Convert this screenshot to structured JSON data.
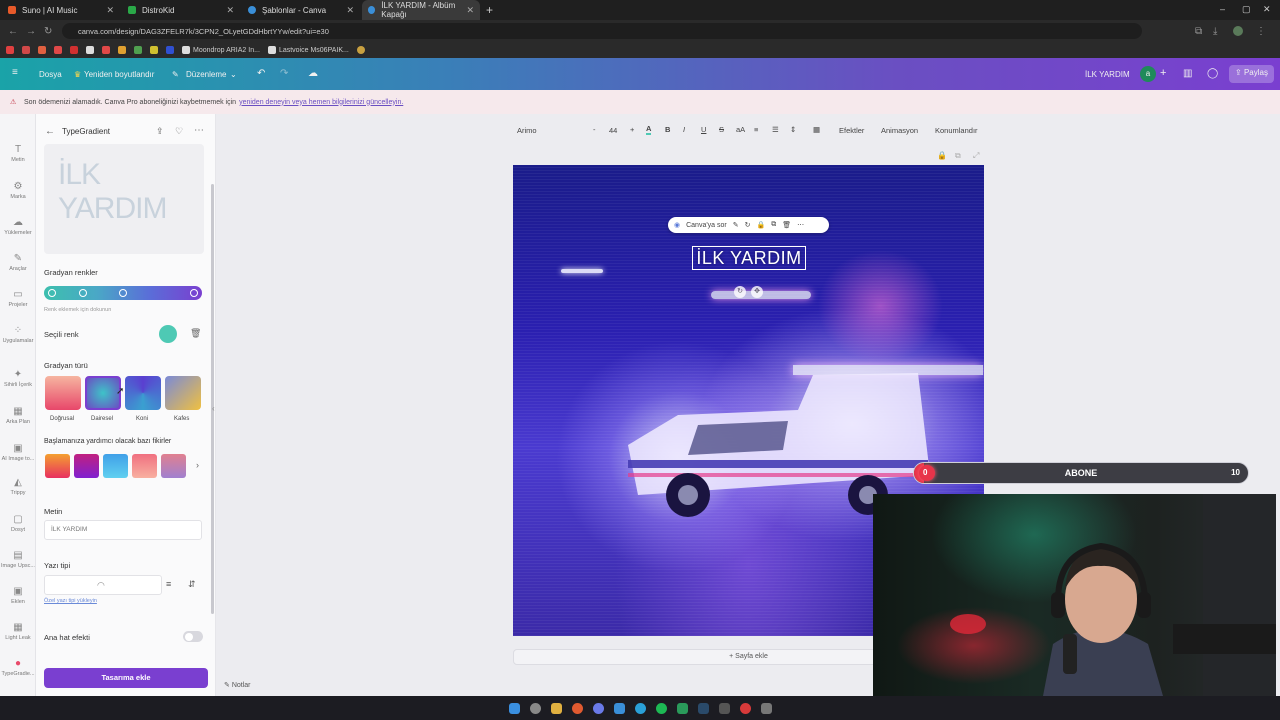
{
  "browser": {
    "tabs": [
      {
        "title": "Suno | AI Music",
        "color": "#e85a2a"
      },
      {
        "title": "DistroKid",
        "color": "#2aa848"
      },
      {
        "title": "Şablonlar - Canva",
        "color": "#3a8fd8"
      },
      {
        "title": "İLK YARDIM - Albüm Kapağı",
        "color": "#3a8fd8",
        "active": true
      }
    ],
    "url": "canva.com/design/DAG3ZFELR7k/3CPN2_OLyetGDdHbrtYYw/edit?ui=e30",
    "bookmarks": [
      "Moondrop ARIA2 In...",
      "Lastvoice Ms06PAIK..."
    ]
  },
  "canva_header": {
    "file": "Dosya",
    "resize": "Yeniden boyutlandır",
    "edit": "Düzenleme",
    "project_title": "İLK YARDIM",
    "avatar": "a",
    "share": "Paylaş",
    "brand_gradient": [
      "#1aa3a8",
      "#6a4fc2",
      "#7a3fd0"
    ]
  },
  "banner": {
    "text": "Son ödemenizi alamadık. Canva Pro aboneliğinizi kaybetmemek için",
    "link": "yeniden deneyin veya hemen bilgilerinizi güncelleyin."
  },
  "rail": [
    "Metin",
    "Marka",
    "Yüklemeler",
    "Araçlar",
    "Projeler",
    "Uygulamalar",
    "Sihirli İçerik",
    "Arka Plan",
    "AI Image to...",
    "Trippy",
    "Dosyt",
    "Image Upsc...",
    "Eklen",
    "Light Leak",
    "TypeGradie..."
  ],
  "panel": {
    "title": "TypeGradient",
    "preview_text": "İLK YARDIM",
    "gradient_colors_label": "Gradyan renkler",
    "gradient_stops": [
      "#3dbfae",
      "#4aa8c6",
      "#5a6ed8",
      "#7a3fd0"
    ],
    "add_color_hint": "Renk eklemek için dokunun",
    "selected_color_label": "Seçili renk",
    "selected_color": "#4ec9b4",
    "gradient_type_label": "Gradyan türü",
    "gradient_types": [
      {
        "label": "Doğrusal",
        "from": "#f6b5a0",
        "to": "#e8476a"
      },
      {
        "label": "Dairesel",
        "from": "#3ec3c8",
        "to": "#6a4fc2",
        "selected": true
      },
      {
        "label": "Koni",
        "from": "#5a3fd0",
        "to": "#3aa0d0"
      },
      {
        "label": "Kafes",
        "from": "#7a8ad8",
        "to": "#f0c040"
      }
    ],
    "presets_label": "Başlamanıza yardımcı olacak bazı fikirler",
    "presets": [
      [
        "#f4a030",
        "#e83060"
      ],
      [
        "#c02080",
        "#8020d0"
      ],
      [
        "#40a0e8",
        "#60d0f0"
      ],
      [
        "#f07080",
        "#f8b0a0"
      ],
      [
        "#e08090",
        "#a080d0"
      ]
    ],
    "text_label": "Metin",
    "text_value": "İLK YARDIM",
    "font_label": "Yazı tipi",
    "font_link": "Özel yazı tipi yükleyin",
    "outline_label": "Ana hat efekti",
    "add_button": "Tasarıma ekle"
  },
  "toolbar": {
    "font": "Arimo",
    "size": "44",
    "effects": "Efektler",
    "animation": "Animasyon",
    "position": "Konumlandır"
  },
  "canvas": {
    "ask_canva": "Canva'ya sor",
    "title_text": "İLK YARDIM",
    "add_page": "+ Sayfa ekle",
    "notes": "Notlar"
  },
  "subscribe_bar": {
    "label": "ABONE",
    "current": "0",
    "goal": "10",
    "progress": 0.03
  }
}
